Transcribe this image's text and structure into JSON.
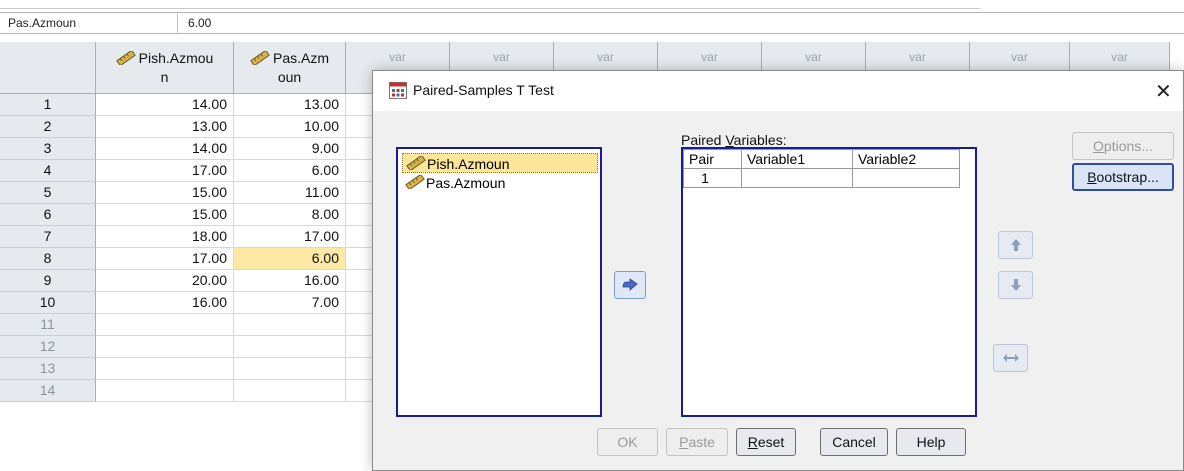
{
  "cell_info": {
    "variable_name": "Pas.Azmoun",
    "cell_value": "6.00"
  },
  "grid": {
    "columns": [
      {
        "label_line1": "Pish.Azmou",
        "label_line2": "n",
        "type": "scale"
      },
      {
        "label_line1": "Pas.Azm",
        "label_line2": "oun",
        "type": "scale"
      },
      {
        "label": "var"
      },
      {
        "label": "var"
      },
      {
        "label": "var"
      },
      {
        "label": "var"
      },
      {
        "label": "var"
      },
      {
        "label": "var"
      },
      {
        "label": "var"
      },
      {
        "label": "var"
      }
    ],
    "rows": [
      {
        "num": "1",
        "c1": "14.00",
        "c2": "13.00"
      },
      {
        "num": "2",
        "c1": "13.00",
        "c2": "10.00"
      },
      {
        "num": "3",
        "c1": "14.00",
        "c2": "9.00"
      },
      {
        "num": "4",
        "c1": "17.00",
        "c2": "6.00"
      },
      {
        "num": "5",
        "c1": "15.00",
        "c2": "11.00"
      },
      {
        "num": "6",
        "c1": "15.00",
        "c2": "8.00"
      },
      {
        "num": "7",
        "c1": "18.00",
        "c2": "17.00"
      },
      {
        "num": "8",
        "c1": "17.00",
        "c2": "6.00",
        "selected": true
      },
      {
        "num": "9",
        "c1": "20.00",
        "c2": "16.00"
      },
      {
        "num": "10",
        "c1": "16.00",
        "c2": "7.00"
      },
      {
        "num": "11",
        "c1": "",
        "c2": ""
      },
      {
        "num": "12",
        "c1": "",
        "c2": ""
      },
      {
        "num": "13",
        "c1": "",
        "c2": ""
      },
      {
        "num": "14",
        "c1": "",
        "c2": ""
      }
    ],
    "selected_color": "#fce9a3"
  },
  "dialog": {
    "title": "Paired-Samples T Test",
    "close_glyph": "✕",
    "source_variables": [
      "Pish.Azmoun",
      "Pas.Azmoun"
    ],
    "selected_source_index": 0,
    "paired_label_pre": "Paired ",
    "paired_label_key": "V",
    "paired_label_post": "ariables:",
    "table_headers": [
      "Pair",
      "Variable1",
      "Variable2"
    ],
    "pairs": [
      {
        "pair": "1",
        "variable1": "",
        "variable2": ""
      }
    ],
    "buttons": {
      "options": {
        "key": "O",
        "rest": "ptions...",
        "enabled": false
      },
      "bootstrap": {
        "key": "B",
        "rest": "ootstrap...",
        "enabled": true
      },
      "ok": {
        "label": "OK",
        "enabled": false
      },
      "paste": {
        "key": "P",
        "rest": "aste",
        "enabled": false
      },
      "reset": {
        "key": "R",
        "rest": "eset",
        "enabled": true
      },
      "cancel": {
        "label": "Cancel",
        "enabled": true
      },
      "help": {
        "label": "Help",
        "enabled": true
      }
    },
    "icons": {
      "move_arrow": "arrow-right-icon",
      "up": "arrow-up-icon",
      "down": "arrow-down-icon",
      "swap": "swap-horizontal-icon"
    },
    "accent_color": "#1a1a9c"
  }
}
